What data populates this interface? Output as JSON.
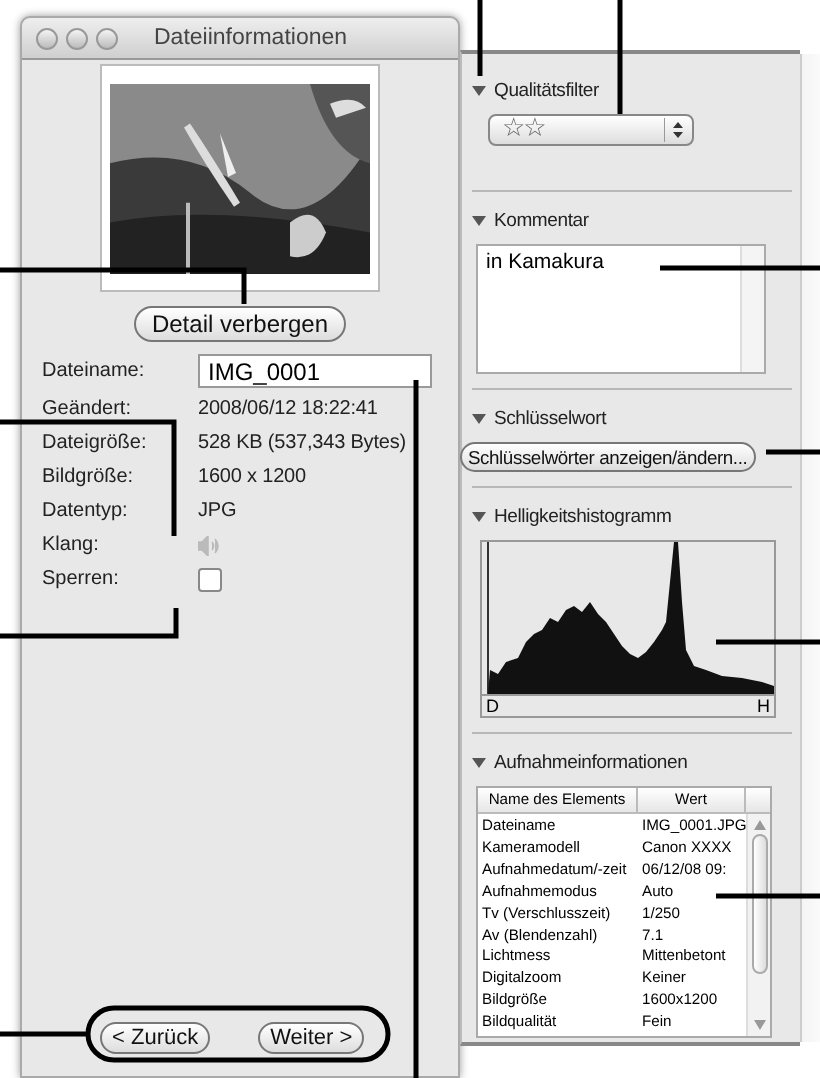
{
  "window": {
    "title": "Dateiinformationen"
  },
  "detail_button": "Detail verbergen",
  "fields": [
    {
      "label": "Dateiname:",
      "kind": "input",
      "value": "IMG_0001"
    },
    {
      "label": "Geändert:",
      "kind": "text",
      "value": "2008/06/12 18:22:41"
    },
    {
      "label": "Dateigröße:",
      "kind": "text",
      "value": "528 KB (537,343 Bytes)"
    },
    {
      "label": "Bildgröße:",
      "kind": "text",
      "value": "1600 x 1200"
    },
    {
      "label": "Datentyp:",
      "kind": "text",
      "value": "JPG"
    },
    {
      "label": "Klang:",
      "kind": "sound",
      "disabled": true
    },
    {
      "label": "Sperren:",
      "kind": "checkbox",
      "checked": false
    }
  ],
  "nav_buttons": [
    "< Zurück",
    "Weiter >"
  ],
  "sections": [
    {
      "title": "Qualitätsfilter",
      "expanded": true,
      "kind": "rating",
      "value": "☆☆"
    },
    {
      "title": "Kommentar",
      "expanded": true,
      "kind": "comment",
      "value": "in Kamakura"
    },
    {
      "title": "Schlüsselwort",
      "expanded": true,
      "kind": "button",
      "label": "Schlüsselwörter anzeigen/ändern..."
    },
    {
      "title": "Helligkeitshistogramm",
      "expanded": true,
      "kind": "histogram",
      "left_label": "D",
      "right_label": "H"
    },
    {
      "title": "Aufnahmeinformationen",
      "expanded": true,
      "kind": "table",
      "columns": [
        "Name des Elements",
        "Wert"
      ],
      "rows": [
        [
          "Dateiname",
          "IMG_0001.JPG"
        ],
        [
          "Kameramodell",
          "Canon XXXX"
        ],
        [
          "Aufnahmedatum/-zeit",
          "06/12/08 09:"
        ],
        [
          "Aufnahmemodus",
          "Auto"
        ],
        [
          "Tv (Verschlusszeit)",
          "1/250"
        ],
        [
          "Av (Blendenzahl)",
          "7.1"
        ],
        [
          "Lichtmess",
          "Mittenbetont"
        ],
        [
          "Digitalzoom",
          "Keiner"
        ],
        [
          "Bildgröße",
          "1600x1200"
        ],
        [
          "Bildqualität",
          "Fein"
        ]
      ]
    }
  ]
}
